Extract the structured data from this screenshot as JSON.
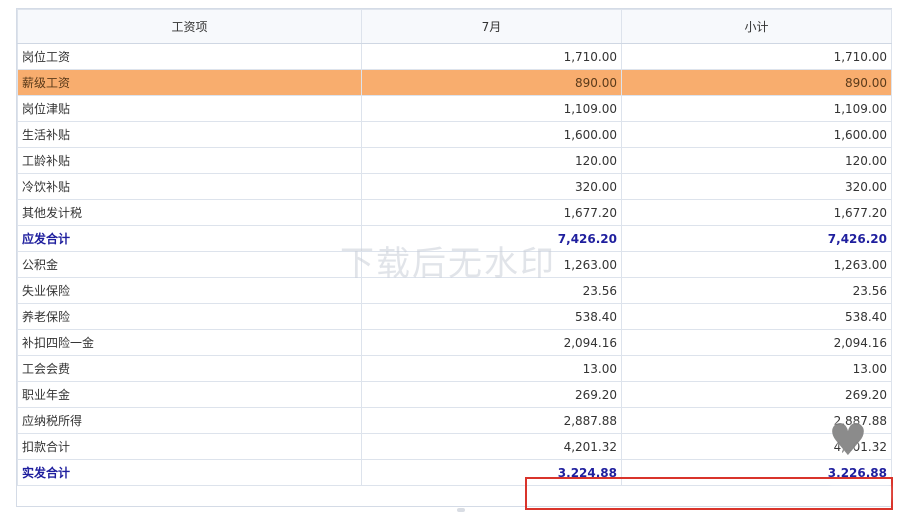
{
  "table": {
    "headers": [
      "工资项",
      "7月",
      "小计"
    ],
    "rows": [
      {
        "name": "岗位工资",
        "month": "1,710.00",
        "subtotal": "1,710.00",
        "style": "normal"
      },
      {
        "name": "薪级工资",
        "month": "890.00",
        "subtotal": "890.00",
        "style": "highlight"
      },
      {
        "name": "岗位津贴",
        "month": "1,109.00",
        "subtotal": "1,109.00",
        "style": "normal"
      },
      {
        "name": "生活补贴",
        "month": "1,600.00",
        "subtotal": "1,600.00",
        "style": "normal"
      },
      {
        "name": "工龄补贴",
        "month": "120.00",
        "subtotal": "120.00",
        "style": "normal"
      },
      {
        "name": "冷饮补贴",
        "month": "320.00",
        "subtotal": "320.00",
        "style": "normal"
      },
      {
        "name": "其他发计税",
        "month": "1,677.20",
        "subtotal": "1,677.20",
        "style": "normal"
      },
      {
        "name": "应发合计",
        "month": "7,426.20",
        "subtotal": "7,426.20",
        "style": "total"
      },
      {
        "name": "公积金",
        "month": "1,263.00",
        "subtotal": "1,263.00",
        "style": "normal"
      },
      {
        "name": "失业保险",
        "month": "23.56",
        "subtotal": "23.56",
        "style": "normal"
      },
      {
        "name": "养老保险",
        "month": "538.40",
        "subtotal": "538.40",
        "style": "normal"
      },
      {
        "name": "补扣四险一金",
        "month": "2,094.16",
        "subtotal": "2,094.16",
        "style": "normal"
      },
      {
        "name": "工会会费",
        "month": "13.00",
        "subtotal": "13.00",
        "style": "normal"
      },
      {
        "name": "职业年金",
        "month": "269.20",
        "subtotal": "269.20",
        "style": "normal"
      },
      {
        "name": "应纳税所得",
        "month": "2,887.88",
        "subtotal": "2,887.88",
        "style": "normal"
      },
      {
        "name": "扣款合计",
        "month": "4,201.32",
        "subtotal": "4,201.32",
        "style": "normal"
      },
      {
        "name": "实发合计",
        "month": "3,224.88",
        "subtotal": "3,226.88",
        "style": "total"
      }
    ]
  },
  "overlay": {
    "watermark": "下载后无水印",
    "heart_icon": "heart-icon",
    "heart_glyph": "♥"
  },
  "colors": {
    "highlight_row": "#f8ad6e",
    "total_text": "#1f1f9e",
    "annotation_box": "#d9342b"
  }
}
